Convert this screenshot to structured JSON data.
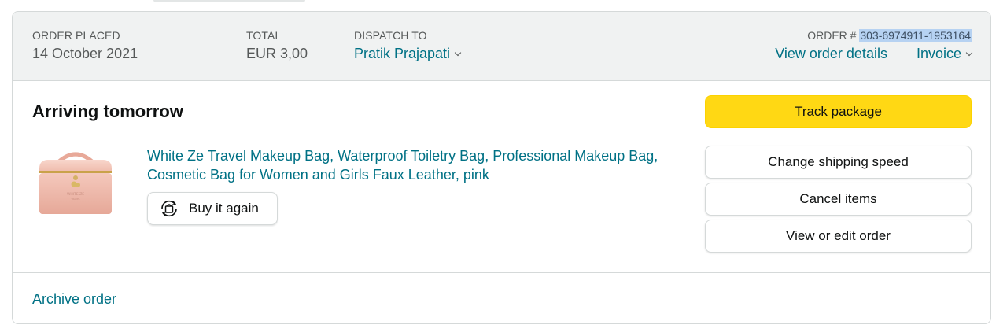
{
  "header": {
    "order_placed": {
      "label": "ORDER PLACED",
      "value": "14 October 2021"
    },
    "total": {
      "label": "TOTAL",
      "value": "EUR 3,00"
    },
    "dispatch_to": {
      "label": "DISPATCH TO",
      "value": "Pratik Prajapati"
    },
    "order_number": {
      "label": "ORDER # ",
      "value": "303-6974911-1953164"
    },
    "view_order_details": "View order details",
    "invoice": "Invoice"
  },
  "shipment": {
    "status": "Arriving tomorrow",
    "product": {
      "title": "White Ze Travel Makeup Bag, Waterproof Toiletry Bag, Professional Makeup Bag, Cosmetic Bag for Women and Girls Faux Leather, pink",
      "image_icon": "pink-makeup-bag-image"
    },
    "buy_again_label": "Buy it again"
  },
  "actions": {
    "track_package": "Track package",
    "change_shipping_speed": "Change shipping speed",
    "cancel_items": "Cancel items",
    "view_or_edit_order": "View or edit order"
  },
  "footer": {
    "archive_order": "Archive order"
  },
  "colors": {
    "link": "#007185",
    "primary_button": "#ffd814",
    "header_bg": "#f0f2f2",
    "selection_highlight": "#b6d2f2",
    "border": "#d5d9d9"
  }
}
